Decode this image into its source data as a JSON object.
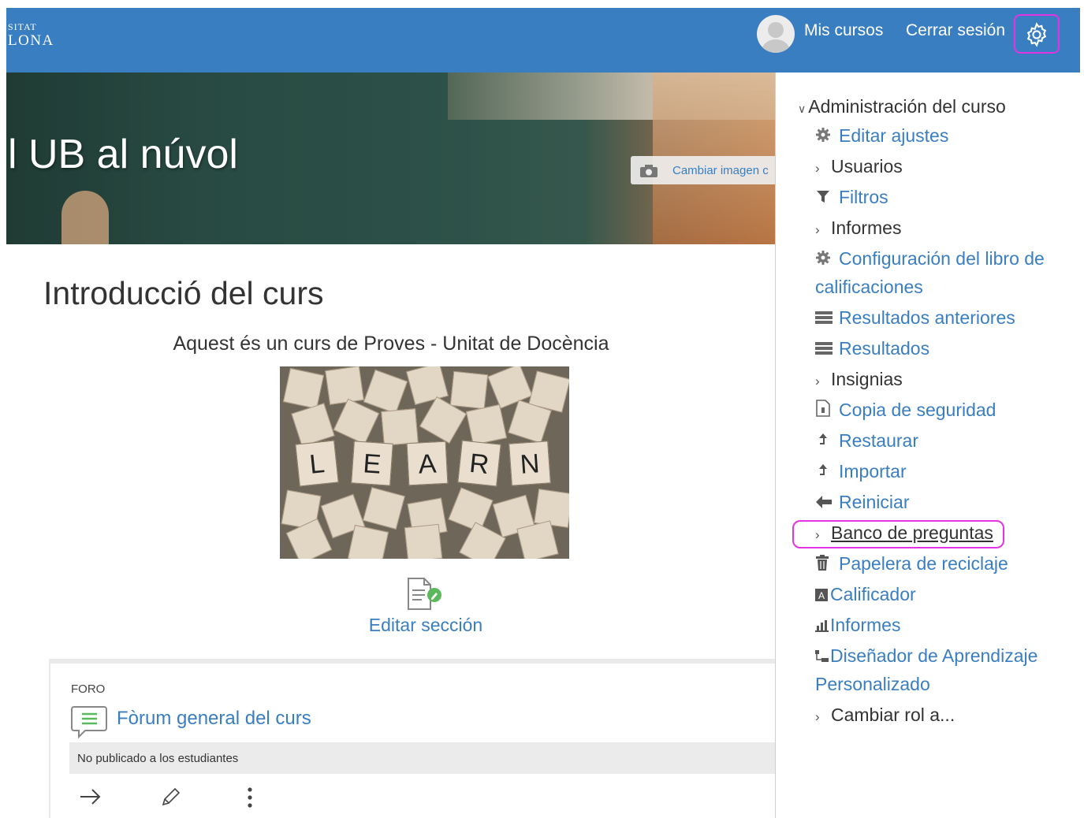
{
  "navbar": {
    "logo_line1": "SITAT",
    "logo_line2": "LONA",
    "my_courses": "Mis cursos",
    "logout": "Cerrar sesión",
    "settings_icon": "gear-icon"
  },
  "banner": {
    "title": "l UB al núvol",
    "change_image": "Cambiar imagen c"
  },
  "section": {
    "title": "Introducció del curs",
    "summary": "Aquest és un curs de Proves - Unitat de Docència",
    "image_letters": [
      "L",
      "E",
      "A",
      "R",
      "N"
    ],
    "edit_label": "Editar sección"
  },
  "activity": {
    "type": "FORO",
    "name": "Fòrum general del curs",
    "visibility_note": "No publicado a los estudiantes"
  },
  "admin": {
    "header": "Administración del curso",
    "items": [
      {
        "label": "Editar ajustes",
        "icon": "gear-icon"
      },
      {
        "label": "Usuarios",
        "icon": "chevron-right-icon"
      },
      {
        "label": "Filtros",
        "icon": "filter-icon"
      },
      {
        "label": "Informes",
        "icon": "chevron-right-icon"
      },
      {
        "label": "Configuración del libro de calificaciones",
        "icon": "gear-icon"
      },
      {
        "label": "Resultados anteriores",
        "icon": "list-icon"
      },
      {
        "label": "Resultados",
        "icon": "list-icon"
      },
      {
        "label": "Insignias",
        "icon": "chevron-right-icon"
      },
      {
        "label": "Copia de seguridad",
        "icon": "file-icon"
      },
      {
        "label": "Restaurar",
        "icon": "upload-icon"
      },
      {
        "label": "Importar",
        "icon": "upload-icon"
      },
      {
        "label": "Reiniciar",
        "icon": "arrow-left-icon"
      },
      {
        "label": "Banco de preguntas",
        "icon": "chevron-right-icon"
      },
      {
        "label": "Papelera de reciclaje",
        "icon": "trash-icon"
      },
      {
        "label": "Calificador",
        "icon": "grade-icon"
      },
      {
        "label": "Informes",
        "icon": "bar-chart-icon"
      },
      {
        "label": "Diseñador de Aprendizaje Personalizado",
        "icon": "tree-icon"
      },
      {
        "label": "Cambiar rol a...",
        "icon": "chevron-right-icon"
      }
    ]
  },
  "colors": {
    "brand": "#3a7ec2",
    "highlight": "#e333e3"
  }
}
